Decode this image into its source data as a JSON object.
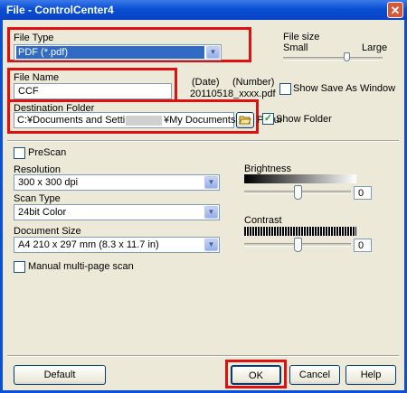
{
  "window": {
    "title": "File - ControlCenter4",
    "close_icon": "✕"
  },
  "file_type": {
    "label": "File Type",
    "value": "PDF (*.pdf)"
  },
  "file_size": {
    "label": "File size",
    "small": "Small",
    "large": "Large",
    "level": 0.65
  },
  "file_name": {
    "label": "File Name",
    "value": "CCF",
    "date_label": "(Date)",
    "number_label": "(Number)",
    "preview": "20110518_xxxx.pdf",
    "show_save_as_window": "Show Save As Window",
    "show_save_as_checked": false
  },
  "destination": {
    "label": "Destination Folder",
    "path_start": "C:¥Documents and Settings¥",
    "path_end": "¥My Documents¥My Pictur",
    "show_folder": "Show Folder",
    "show_folder_checked": true,
    "browse_icon": "folder-open-icon"
  },
  "prescan": {
    "label": "PreScan",
    "checked": false
  },
  "resolution": {
    "label": "Resolution",
    "value": "300 x 300 dpi"
  },
  "scan_type": {
    "label": "Scan Type",
    "value": "24bit Color"
  },
  "document_size": {
    "label": "Document Size",
    "value": "A4 210 x 297 mm (8.3 x 11.7 in)"
  },
  "manual_multipage": {
    "label": "Manual multi-page scan",
    "checked": false
  },
  "brightness": {
    "label": "Brightness",
    "value": "0",
    "level": 0.5
  },
  "contrast": {
    "label": "Contrast",
    "value": "0",
    "level": 0.5
  },
  "buttons": {
    "default": "Default",
    "ok": "OK",
    "cancel": "Cancel",
    "help": "Help"
  },
  "colors": {
    "highlight_red": "#e01010",
    "selection_blue": "#316ac5",
    "title_blue": "#0a4fd4"
  }
}
